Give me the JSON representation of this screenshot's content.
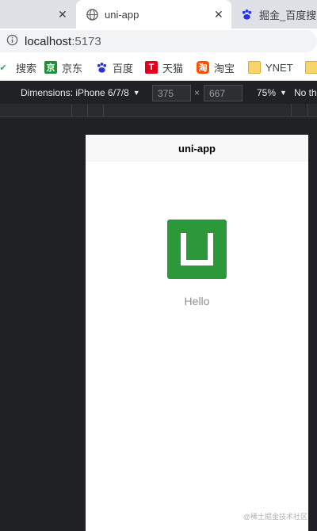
{
  "browser": {
    "tabs": [
      {
        "label": "",
        "close": "✕"
      },
      {
        "label": "uni-app",
        "close": "✕"
      },
      {
        "label": "掘金_百度搜索"
      }
    ],
    "url": {
      "host": "localhost",
      "port": ":5173"
    },
    "bookmarks": [
      "搜索",
      "京东",
      "百度",
      "天猫",
      "淘宝",
      "YNET"
    ]
  },
  "device_toolbar": {
    "dimensions_label": "Dimensions: iPhone 6/7/8",
    "width": "375",
    "times": "×",
    "height": "667",
    "zoom": "75%",
    "throttle": "No th"
  },
  "app": {
    "nav_title": "uni-app",
    "greeting": "Hello"
  },
  "watermark": "@稀土掘金技术社区",
  "colors": {
    "logo_green": "#2b9939",
    "hello_text": "#8f8f94"
  }
}
